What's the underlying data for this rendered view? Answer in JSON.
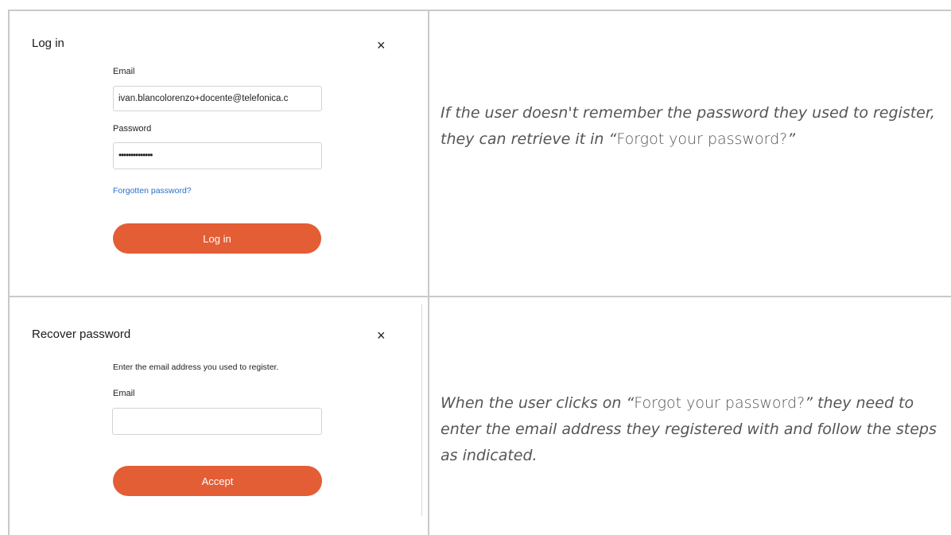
{
  "login_modal": {
    "title": "Log in",
    "close_glyph": "×",
    "email_label": "Email",
    "email_value": "ivan.blancolorenzo+docente@telefonica.c",
    "password_label": "Password",
    "password_value": "••••••••••••••",
    "forgot_link": "Forgotten password?",
    "submit_label": "Log in"
  },
  "recover_modal": {
    "title": "Recover password",
    "close_glyph": "×",
    "instruction": "Enter the email address you used to register.",
    "email_label": "Email",
    "email_value": "",
    "submit_label": "Accept"
  },
  "descriptions": {
    "login": {
      "part1": "If the user doesn't remember the password they used to register, they can retrieve it in “",
      "quoted": "Forgot your password?",
      "part2": "”"
    },
    "recover": {
      "part1": "When the user clicks on “",
      "quoted": "Forgot your password?",
      "part2": "” they need to enter the email address they registered with and follow the steps as indicated."
    }
  },
  "colors": {
    "button": "#e35d35",
    "link": "#2a6fcb",
    "grid_line": "#c9c9c9"
  }
}
